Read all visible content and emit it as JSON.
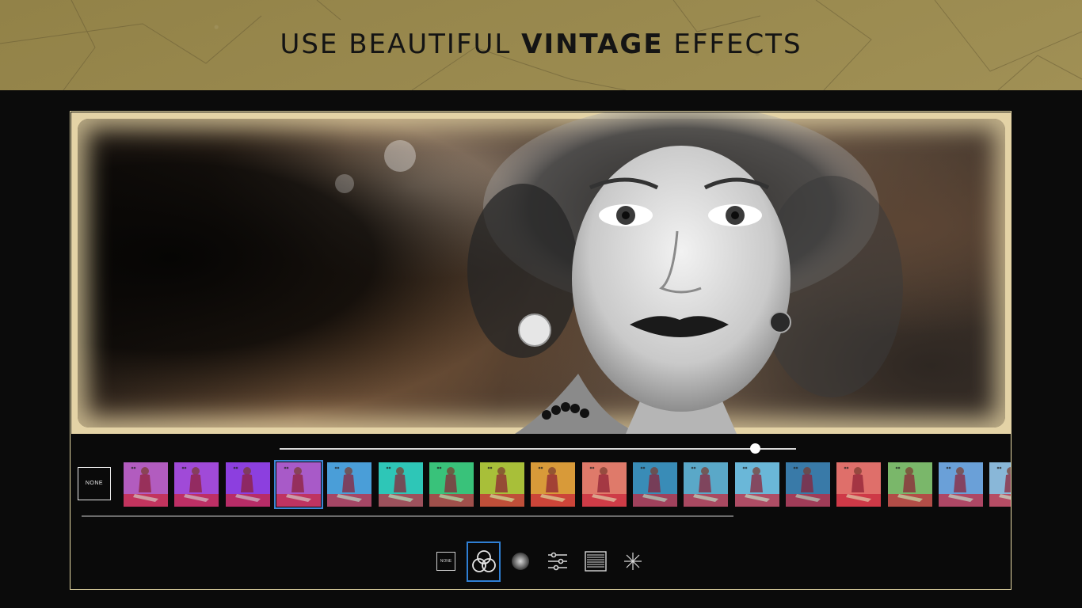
{
  "banner": {
    "headline_prefix": "USE BEAUTIFUL",
    "headline_bold": "VINTAGE",
    "headline_suffix": "EFFECTS"
  },
  "editor": {
    "intensity_slider": {
      "value": 0.92
    },
    "none_label": "NONE",
    "filters": {
      "selected_index": 3,
      "items": [
        {
          "tint": "#b25cc0"
        },
        {
          "tint": "#a04ad8"
        },
        {
          "tint": "#8c3fe0"
        },
        {
          "tint": "#a85ac8"
        },
        {
          "tint": "#4a9fd8"
        },
        {
          "tint": "#2ec6b8"
        },
        {
          "tint": "#3ac27a"
        },
        {
          "tint": "#a8c03a"
        },
        {
          "tint": "#d89a3a"
        },
        {
          "tint": "#e07a6a"
        },
        {
          "tint": "#3a8cb8"
        },
        {
          "tint": "#5aa8c8"
        },
        {
          "tint": "#6ab8d8"
        },
        {
          "tint": "#3a7aa8"
        },
        {
          "tint": "#e0706a"
        },
        {
          "tint": "#7ab86a"
        },
        {
          "tint": "#6aa0d8"
        },
        {
          "tint": "#8ab8d8"
        }
      ]
    },
    "toolbar": {
      "none_label": "NONE",
      "active_tool": "filters",
      "tools": [
        "none",
        "filters",
        "vignette",
        "adjust",
        "texture",
        "light-leak"
      ]
    },
    "colors": {
      "banner": "#9b8a4c",
      "frame_border": "#e6d9a6",
      "selection": "#3d86d6"
    }
  }
}
